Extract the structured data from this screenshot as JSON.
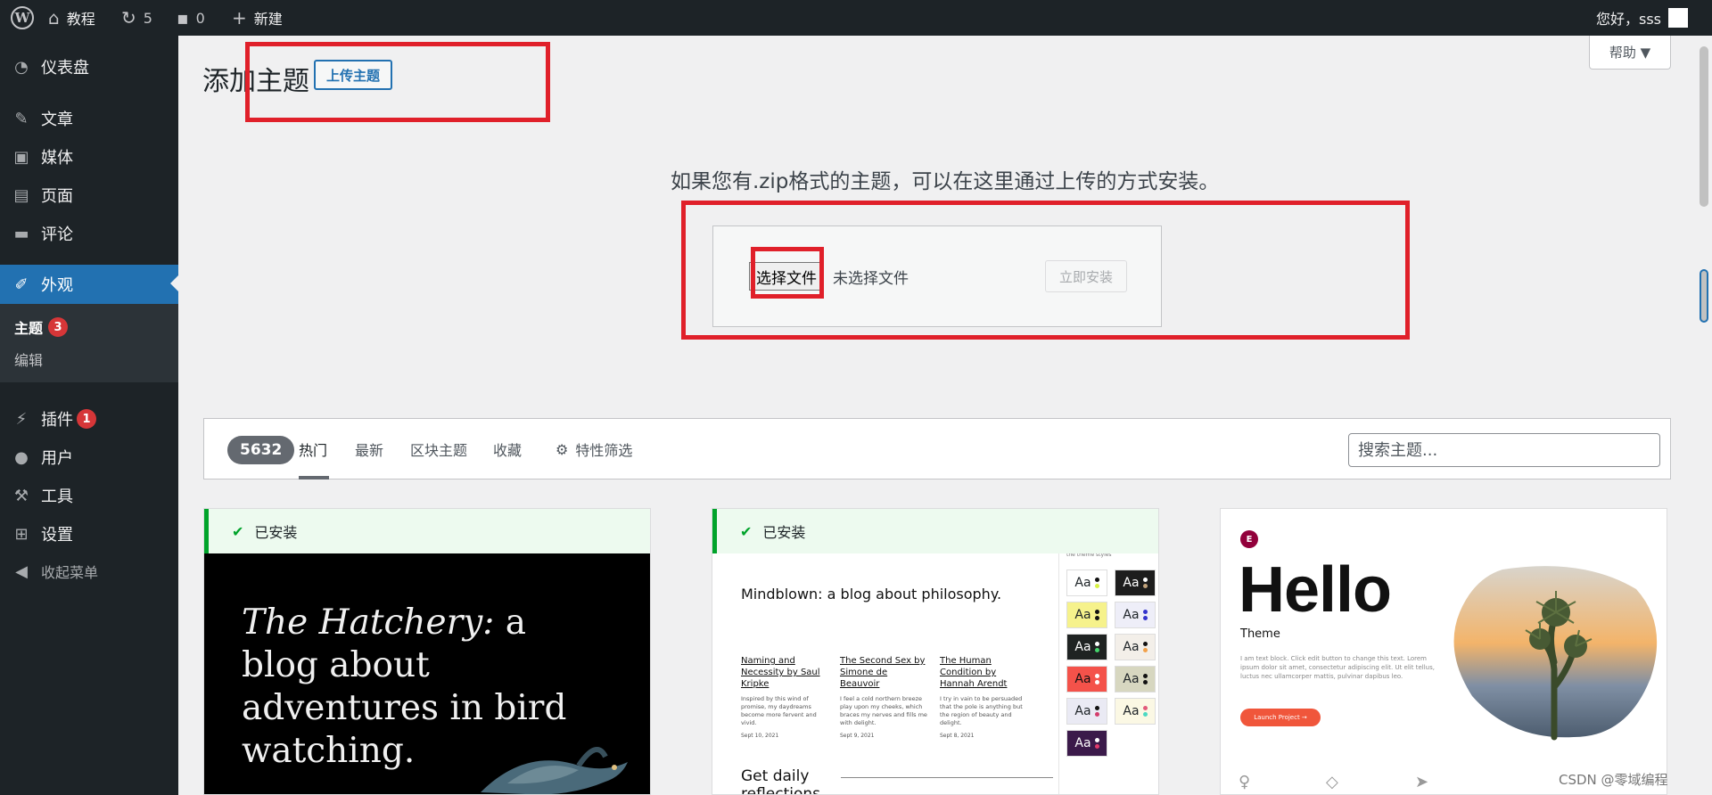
{
  "admin_bar": {
    "site_name": "教程",
    "updates_count": "5",
    "comments_count": "0",
    "new_label": "新建",
    "greeting": "您好，sss"
  },
  "sidebar": {
    "items": [
      {
        "label": "仪表盘",
        "icon": "dashboard-icon"
      },
      {
        "label": "文章",
        "icon": "pin-icon"
      },
      {
        "label": "媒体",
        "icon": "media-icon"
      },
      {
        "label": "页面",
        "icon": "page-icon"
      },
      {
        "label": "评论",
        "icon": "comment-icon"
      },
      {
        "label": "外观",
        "icon": "appearance-icon"
      },
      {
        "label": "插件",
        "icon": "plugin-icon",
        "badge": "1"
      },
      {
        "label": "用户",
        "icon": "user-icon"
      },
      {
        "label": "工具",
        "icon": "wrench-icon"
      },
      {
        "label": "设置",
        "icon": "settings-icon"
      },
      {
        "label": "收起菜单",
        "icon": "collapse-icon"
      }
    ],
    "submenu": [
      {
        "label": "主题",
        "badge": "3"
      },
      {
        "label": "编辑"
      }
    ]
  },
  "main": {
    "title": "添加主题",
    "upload_button": "上传主题",
    "help_label": "帮助 ▼",
    "upload_help_text": "如果您有.zip格式的主题，可以在这里通过上传的方式安装。",
    "choose_file_label": "选择文件",
    "no_file_label": "未选择文件",
    "install_now_label": "立即安装"
  },
  "filter_bar": {
    "count": "5632",
    "tabs": [
      "热门",
      "最新",
      "区块主题",
      "收藏"
    ],
    "feature_filter": "特性筛选",
    "search_placeholder": "搜索主题..."
  },
  "themes": [
    {
      "installed_label": "已安装",
      "screenshot_text_italic": "The Hatchery:",
      "screenshot_text_rest": " a blog about adventures in bird watching."
    },
    {
      "installed_label": "已安装",
      "panel_top": "the theme styles",
      "screenshot_title": "Mindblown: a blog about philosophy.",
      "columns": [
        {
          "title": "Naming and Necessity by Saul Kripke",
          "body": "Inspired by this wind of promise, my daydreams become more fervent and vivid.",
          "date": "Sept 10, 2021"
        },
        {
          "title": "The Second Sex by Simone de Beauvoir",
          "body": "I feel a cold northern breeze play upon my cheeks, which braces my nerves and fills me with delight.",
          "date": "Sept 9, 2021"
        },
        {
          "title": "The Human Condition by Hannah Arendt",
          "body": "I try in vain to be persuaded that the pole is anything but the region of beauty and delight.",
          "date": "Sept 8, 2021"
        }
      ],
      "footer_text": "Get daily reflections",
      "swatch_label": "Aa"
    },
    {
      "logo_letter": "E",
      "hello_title": "Hello",
      "hello_sub": "Theme",
      "lorem": "I am text block. Click edit button to change this text. Lorem ipsum dolor sit amet, consectetur adipiscing elit. Ut elit tellus, luctus nec ullamcorper mattis, pulvinar dapibus leo.",
      "launch_label": "Launch Project  →"
    }
  ],
  "watermark": "CSDN @零域编程",
  "colors": {
    "admin_dark": "#1d2327",
    "accent_blue": "#2271b1",
    "highlight_red": "#e0202a",
    "badge_red": "#d63638",
    "installed_green": "#00a32a"
  }
}
